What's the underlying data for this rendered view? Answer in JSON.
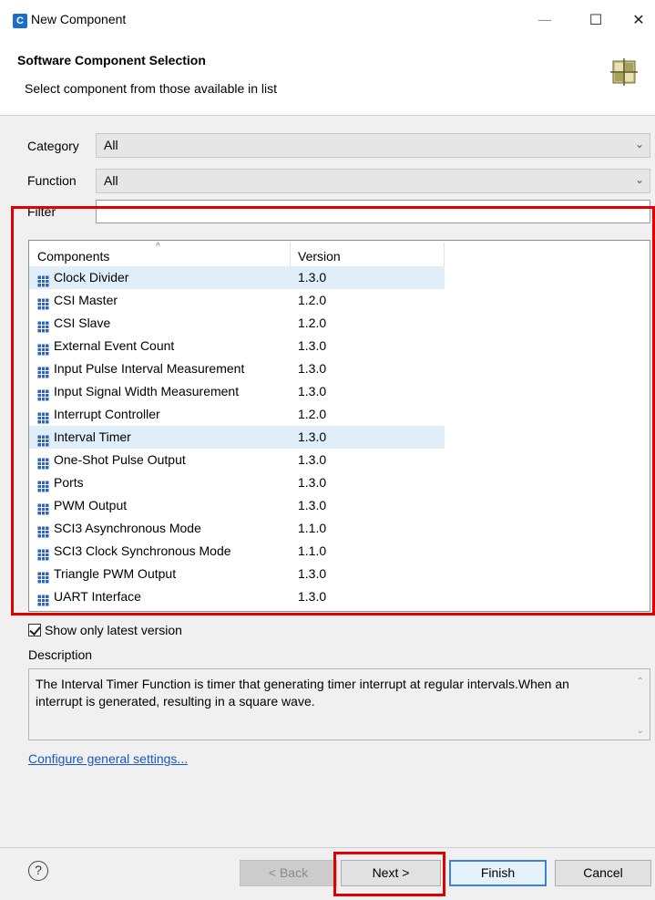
{
  "window": {
    "title": "New Component",
    "app_icon_letter": "C",
    "minimize_symbol": "—",
    "maximize_symbol": "☐",
    "close_symbol": "✕"
  },
  "header": {
    "title": "Software Component Selection",
    "subtitle": "Select component from those available in list",
    "graphic": "component-grid-icon"
  },
  "form": {
    "category_label": "Category",
    "category_value": "All",
    "function_label": "Function",
    "function_value": "All",
    "filter_label": "Filter",
    "filter_value": ""
  },
  "table": {
    "columns": [
      "Components",
      "Version"
    ],
    "sort_indicator": "^",
    "icon": "component-grid-icon",
    "rows": [
      {
        "name": "Clock Divider",
        "version": "1.3.0",
        "selected": true
      },
      {
        "name": "CSI Master",
        "version": "1.2.0",
        "selected": false
      },
      {
        "name": "CSI Slave",
        "version": "1.2.0",
        "selected": false
      },
      {
        "name": "External Event Count",
        "version": "1.3.0",
        "selected": false
      },
      {
        "name": "Input Pulse Interval Measurement",
        "version": "1.3.0",
        "selected": false
      },
      {
        "name": "Input Signal Width Measurement",
        "version": "1.3.0",
        "selected": false
      },
      {
        "name": "Interrupt Controller",
        "version": "1.2.0",
        "selected": false
      },
      {
        "name": "Interval Timer",
        "version": "1.3.0",
        "selected": true
      },
      {
        "name": "One-Shot Pulse Output",
        "version": "1.3.0",
        "selected": false
      },
      {
        "name": "Ports",
        "version": "1.3.0",
        "selected": false
      },
      {
        "name": "PWM Output",
        "version": "1.3.0",
        "selected": false
      },
      {
        "name": "SCI3 Asynchronous Mode",
        "version": "1.1.0",
        "selected": false
      },
      {
        "name": "SCI3 Clock Synchronous Mode",
        "version": "1.1.0",
        "selected": false
      },
      {
        "name": "Triangle PWM Output",
        "version": "1.3.0",
        "selected": false
      },
      {
        "name": "UART Interface",
        "version": "1.3.0",
        "selected": false
      }
    ]
  },
  "options": {
    "show_latest_label": "Show only latest version",
    "show_latest_checked": true
  },
  "description": {
    "label": "Description",
    "text": "The Interval Timer Function is timer that generating timer interrupt at regular intervals.When an interrupt is generated, resulting in a square wave."
  },
  "links": {
    "configure": "Configure general settings..."
  },
  "footer": {
    "help_symbol": "?",
    "back_label": "< Back",
    "next_label": "Next >",
    "finish_label": "Finish",
    "cancel_label": "Cancel"
  },
  "colors": {
    "highlight_outline": "#e00000",
    "selected_row": "#e0eef9",
    "link": "#1a56c2",
    "default_button_border": "#3c83d4"
  }
}
